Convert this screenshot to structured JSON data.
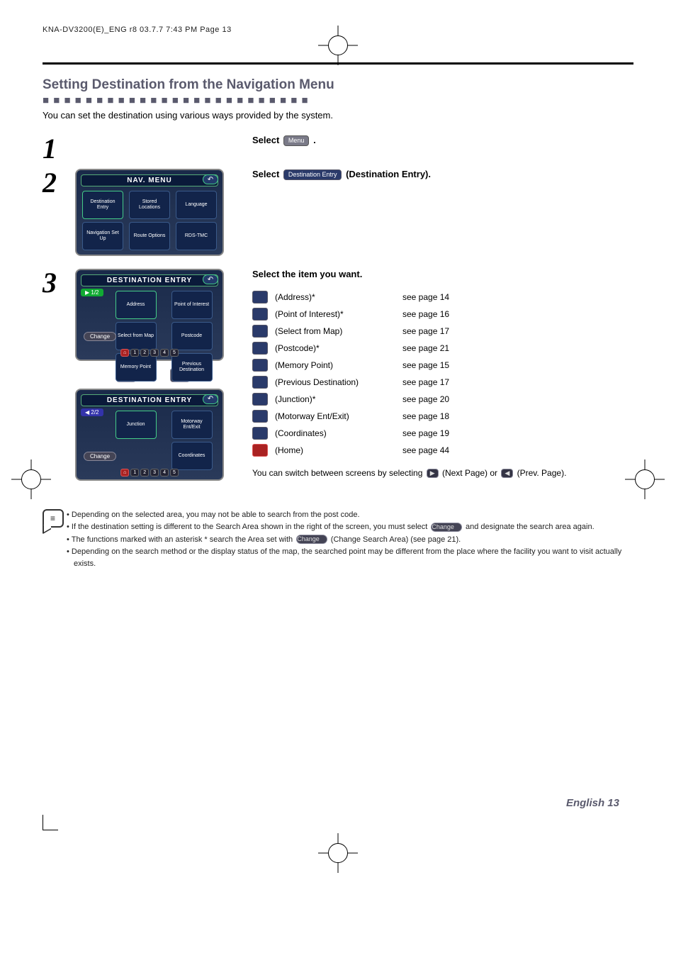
{
  "header": {
    "slug": "KNA-DV3200(E)_ENG r8  03.7.7  7:43 PM  Page 13"
  },
  "section": {
    "title": "Setting Destination from the Navigation Menu",
    "intro": "You can set the destination using various ways provided by the system."
  },
  "steps": {
    "s1": {
      "num": "1",
      "text_a": "Select ",
      "chip": "Menu",
      "text_b": " ."
    },
    "s2": {
      "num": "2",
      "text_a": "Select ",
      "chip": "Destination Entry",
      "text_b": " (Destination Entry)."
    },
    "s3": {
      "num": "3",
      "heading": "Select the item you want."
    }
  },
  "device_nav": {
    "title": "NAV. MENU",
    "cells": [
      "Destination Entry",
      "Stored Locations",
      "Language",
      "Navigation Set Up",
      "Route Options",
      "RDS-TMC"
    ],
    "tmc": "TMC"
  },
  "device_dest1": {
    "title": "DESTINATION ENTRY",
    "page": "1/2",
    "cells": [
      "Address",
      "Point of Interest",
      "Select from Map",
      "Postcode",
      "Memory Point",
      "Previous Destination"
    ],
    "change": "Change",
    "pager": [
      "1",
      "2",
      "3",
      "4",
      "5"
    ]
  },
  "device_dest2": {
    "title": "DESTINATION ENTRY",
    "page": "2/2",
    "cells": [
      "Junction",
      "Motorway Ent/Exit",
      "Coordinates"
    ],
    "change": "Change",
    "pager": [
      "1",
      "2",
      "3",
      "4",
      "5"
    ]
  },
  "items": [
    {
      "name": "(Address)*",
      "ref": "see page 14"
    },
    {
      "name": "(Point of Interest)*",
      "ref": "see page 16"
    },
    {
      "name": "(Select from Map)",
      "ref": "see page 17"
    },
    {
      "name": "(Postcode)*",
      "ref": "see page 21"
    },
    {
      "name": "(Memory Point)",
      "ref": "see page 15"
    },
    {
      "name": "(Previous Destination)",
      "ref": "see page 17"
    },
    {
      "name": "(Junction)*",
      "ref": "see page 20"
    },
    {
      "name": "(Motorway Ent/Exit)",
      "ref": "see page 18"
    },
    {
      "name": "(Coordinates)",
      "ref": "see page 19"
    },
    {
      "name": "(Home)",
      "ref": "see page 44",
      "home": true
    }
  ],
  "switch_note": {
    "a": "You can switch between screens by selecting ",
    "next": "▶",
    "b": " (Next Page) or ",
    "prev": "◀",
    "c": " (Prev. Page)."
  },
  "notes": {
    "n1": "Depending on the selected area, you may not be able to search from the post code.",
    "n2a": "If the destination setting is different to the Search Area shown in the right of the screen, you must select ",
    "n2chip": "Change",
    "n2b": " and designate the search area again.",
    "n3a": "The functions marked with an asterisk * search the Area set with ",
    "n3chip": "Change",
    "n3b": " (Change Search Area) (see page 21).",
    "n4": "Depending on the search method or the display status of the map, the searched point may be different from the place where the facility you want to visit actually exists."
  },
  "footer": {
    "text": "English 13"
  }
}
